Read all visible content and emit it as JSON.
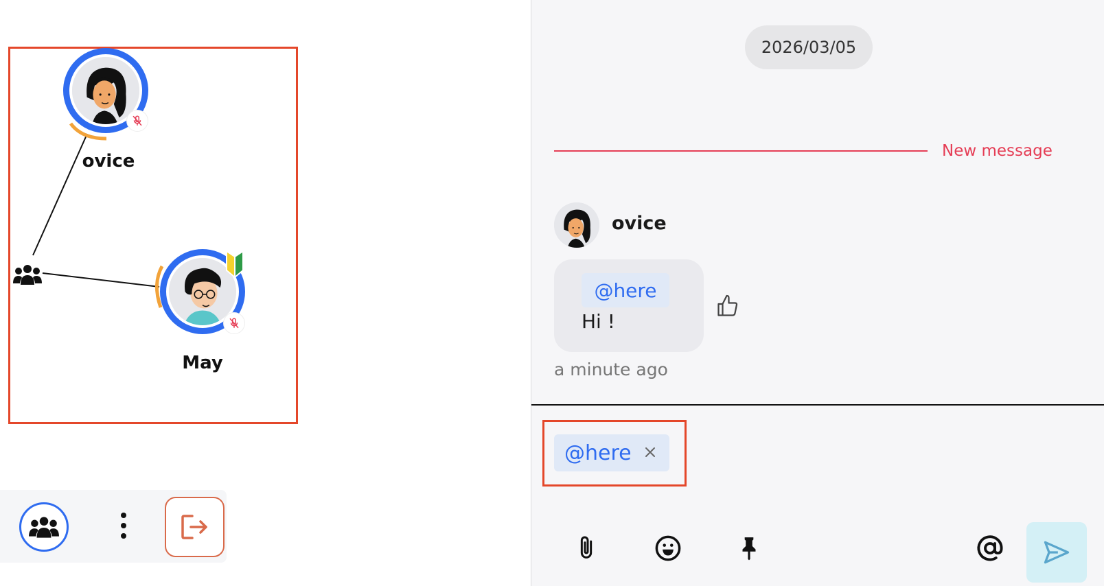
{
  "space": {
    "members": [
      {
        "name": "ovice",
        "muted": true
      },
      {
        "name": "May",
        "muted": true,
        "beginner_badge": true
      }
    ],
    "group_node_icon": "group-icon",
    "toolbar": {
      "members_icon": "members-icon",
      "more_icon": "more-vertical-icon",
      "leave_icon": "leave-icon"
    }
  },
  "chat": {
    "date": "2026/03/05",
    "new_message_label": "New message",
    "messages": [
      {
        "author": "ovice",
        "mention": "@here",
        "text": "Hi !",
        "time": "a minute ago"
      }
    ],
    "composer": {
      "mention_chip": "@here",
      "buttons": [
        "attach-icon",
        "emoji-icon",
        "pin-icon",
        "mention-icon",
        "send-icon"
      ]
    }
  },
  "colors": {
    "accent_blue": "#2f6cf0",
    "highlight_red": "#e4472a",
    "new_message_red": "#e53d55",
    "leave_orange": "#d96a4a"
  }
}
